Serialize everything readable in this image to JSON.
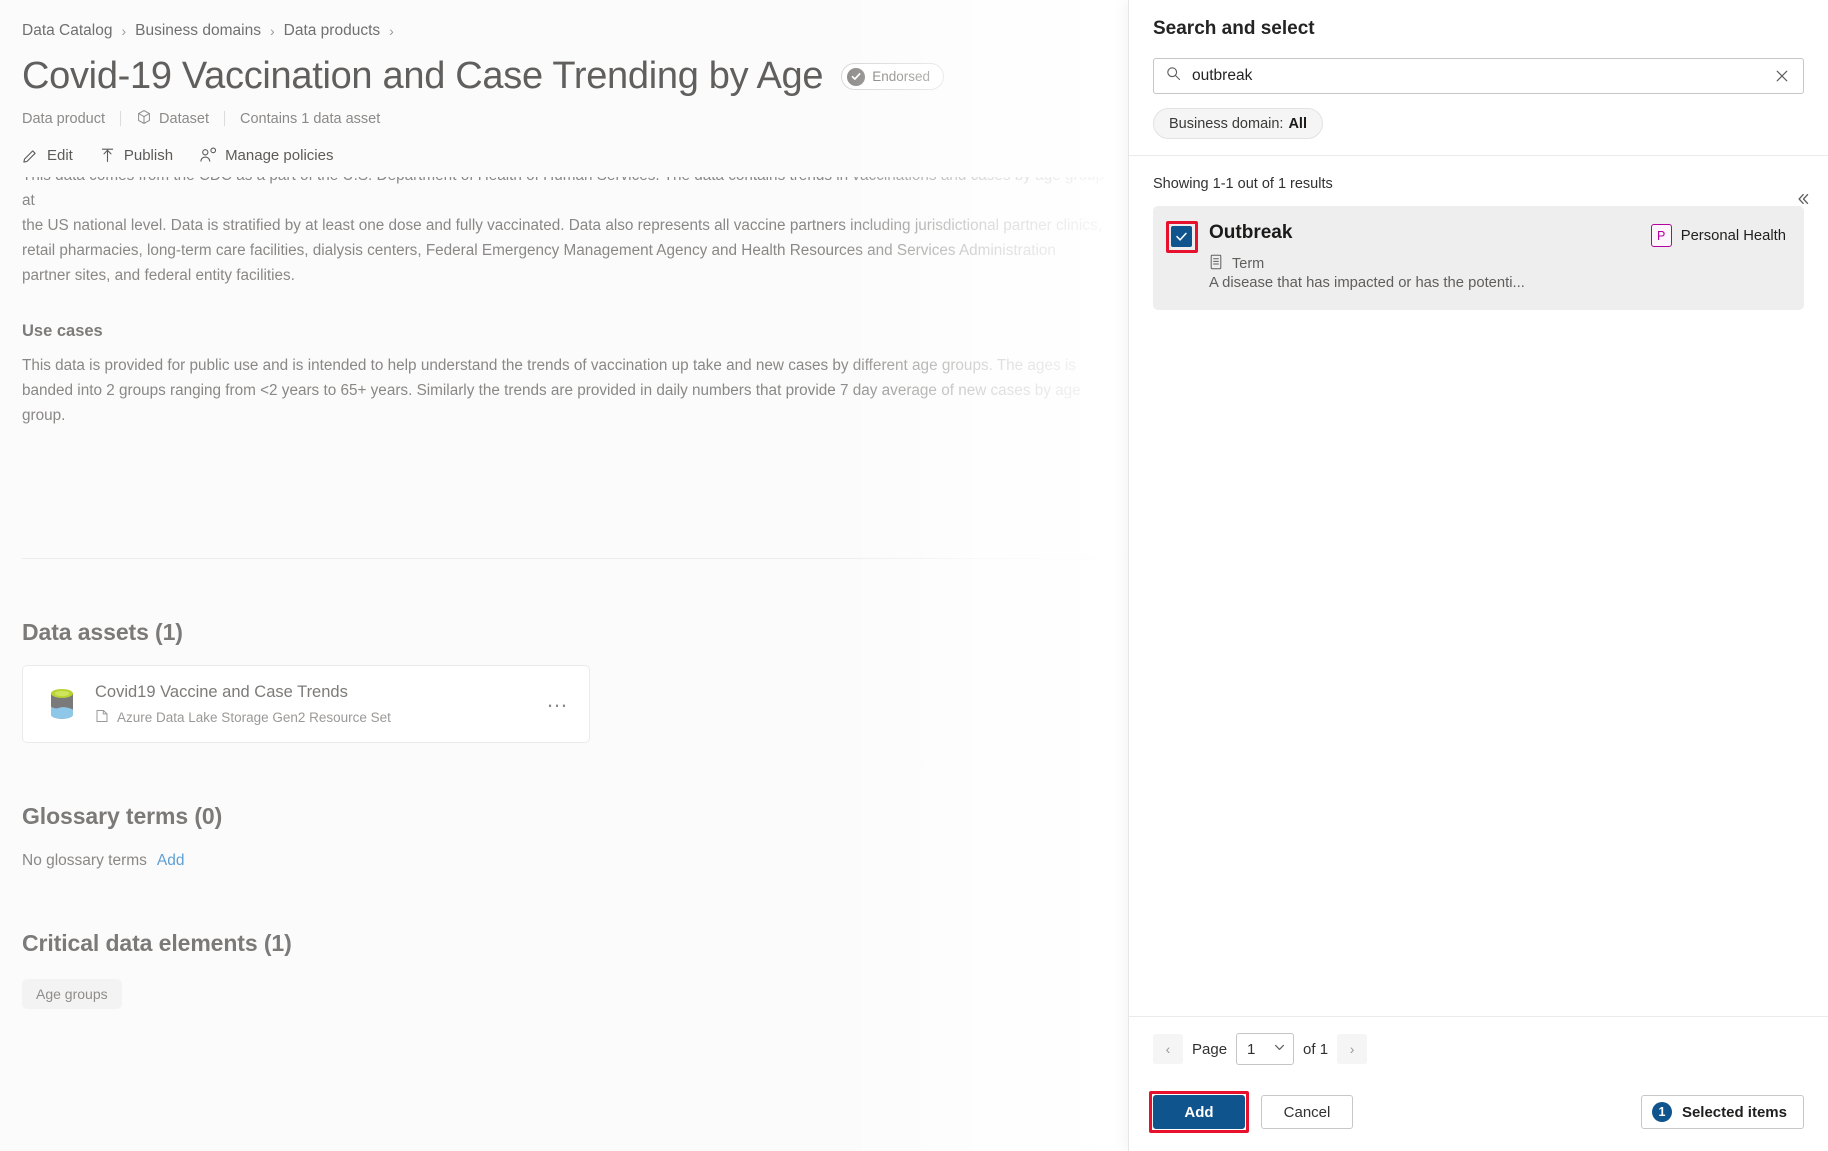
{
  "breadcrumb": {
    "items": [
      "Data Catalog",
      "Business domains",
      "Data products"
    ],
    "separator": "›"
  },
  "header": {
    "title": "Covid-19 Vaccination and Case Trending by Age",
    "endorsed_label": "Endorsed",
    "meta": {
      "kind": "Data product",
      "type": "Dataset",
      "assets": "Contains 1 data asset"
    }
  },
  "commandbar": {
    "edit": "Edit",
    "publish": "Publish",
    "manage_policies": "Manage policies"
  },
  "description": {
    "line_clipped": "This data comes from the CDC as a part of the U.S. Department of Health of Human Services. The data contains trends in vaccinations and cases by age group at",
    "paragraph": "the US national level. Data is stratified by at least one dose and fully vaccinated. Data also represents all vaccine partners including jurisdictional partner clinics, retail pharmacies, long-term care facilities, dialysis centers, Federal Emergency Management Agency and Health Resources and Services Administration partner sites, and federal entity facilities.",
    "use_cases_heading": "Use cases",
    "use_cases_text": "This data is provided for public use and is intended to help understand the trends of vaccination up take and new cases by different age groups.  The ages is banded into 2 groups ranging from <2 years to 65+ years.  Similarly the trends are provided in daily numbers that provide 7 day average of new cases by age group."
  },
  "data_assets": {
    "heading": "Data assets (1)",
    "items": [
      {
        "name": "Covid19 Vaccine and Case Trends",
        "source": "Azure Data Lake Storage Gen2 Resource Set",
        "more": "…"
      }
    ]
  },
  "glossary_terms": {
    "heading": "Glossary terms (0)",
    "empty_text": "No glossary terms",
    "add_link": "Add"
  },
  "critical_data_elements": {
    "heading": "Critical data elements (1)",
    "items": [
      "Age groups"
    ]
  },
  "panel": {
    "title": "Search and select",
    "search": {
      "value": "outbreak",
      "placeholder": "Search",
      "icon": "search-icon",
      "clear_icon": "close-icon"
    },
    "filter": {
      "label": "Business domain:",
      "value": "All"
    },
    "results_count": "Showing 1-1 out of 1 results",
    "results": [
      {
        "name": "Outbreak",
        "type": "Term",
        "description": "A disease that has impacted or has the potenti...",
        "domain_initial": "P",
        "domain_name": "Personal Health",
        "checked": true
      }
    ],
    "pager": {
      "prev": "‹",
      "next": "›",
      "page_label": "Page",
      "current_page": "1",
      "of_label": "of 1"
    },
    "actions": {
      "add": "Add",
      "cancel": "Cancel",
      "selected_count": "1",
      "selected_label": "Selected items"
    },
    "collapse_icon": "chevron-double-left-icon"
  },
  "colors": {
    "accent": "#0f548c",
    "highlight": "#e8112d",
    "domain_tag": "#b4009e",
    "link": "#5f9fd4"
  }
}
